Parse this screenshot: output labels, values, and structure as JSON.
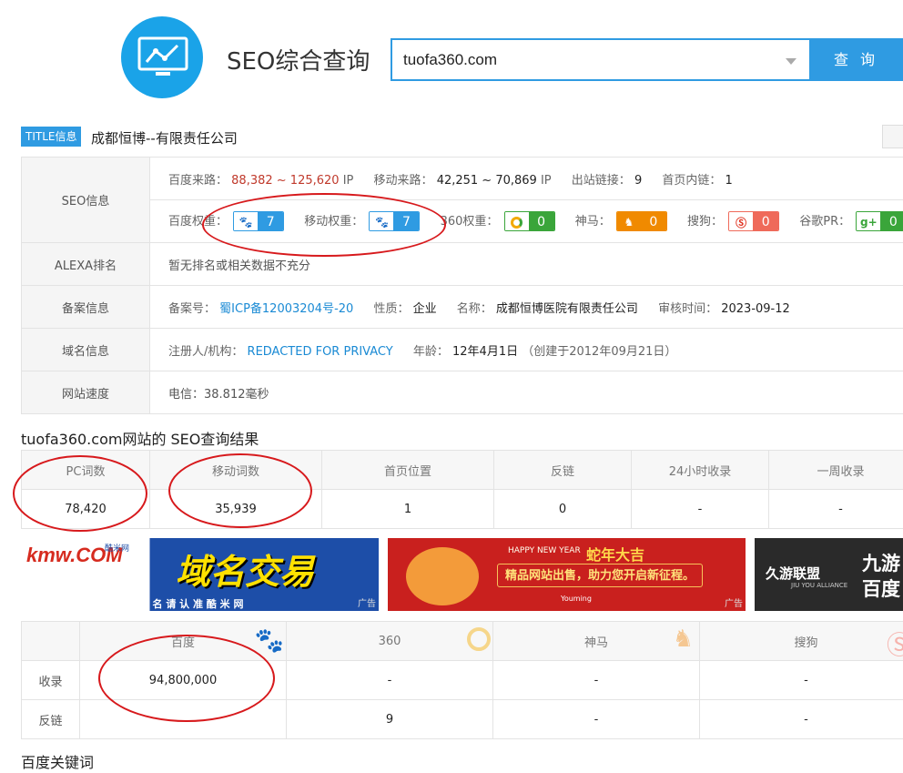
{
  "header": {
    "brand": "SEO综合查询",
    "search_value": "tuofa360.com",
    "search_button": "查 询"
  },
  "title_row": {
    "tag": "TITLE信息",
    "text": "成都恒博--有限责任公司"
  },
  "info": {
    "seo_label": "SEO信息",
    "baidu_traffic_label": "百度来路：",
    "baidu_traffic_value": "88,382 ~ 125,620",
    "ip_unit": "IP",
    "mobile_traffic_label": "移动来路：",
    "mobile_traffic_value": "42,251 ~ 70,869",
    "outbound_label": "出站链接：",
    "outbound_value": "9",
    "home_links_label": "首页内链：",
    "home_links_value": "1",
    "baidu_weight_label": "百度权重：",
    "baidu_weight_value": "7",
    "mobile_weight_label": "移动权重：",
    "mobile_weight_value": "7",
    "weight360_label": "360权重：",
    "weight360_value": "0",
    "shenma_label": "神马：",
    "shenma_value": "0",
    "sogou_label": "搜狗：",
    "sogou_value": "0",
    "google_label": "谷歌PR：",
    "google_value": "0",
    "alexa_label": "ALEXA排名",
    "alexa_value": "暂无排名或相关数据不充分",
    "beian_label": "备案信息",
    "icp_label": "备案号：",
    "icp_value": "蜀ICP备12003204号-20",
    "nature_label": "性质：",
    "nature_value": "企业",
    "name_label": "名称：",
    "name_value": "成都恒博医院有限责任公司",
    "audit_label": "审核时间：",
    "audit_value": "2023-09-12",
    "domain_label": "域名信息",
    "registrant_label": "注册人/机构：",
    "registrant_value": "REDACTED FOR PRIVACY",
    "age_label": "年龄：",
    "age_value": "12年4月1日",
    "created_value": "（创建于2012年09月21日）",
    "speed_label": "网站速度",
    "speed_value": "电信：38.812毫秒"
  },
  "seo_results": {
    "title": "tuofa360.com网站的 SEO查询结果",
    "headers": [
      "PC词数",
      "移动词数",
      "首页位置",
      "反链",
      "24小时收录",
      "一周收录"
    ],
    "values": [
      "78,420",
      "35,939",
      "1",
      "0",
      "-",
      "-"
    ]
  },
  "ads": {
    "ad1_logo": "kmw.COM",
    "ad1_logo_small": "酷米网",
    "ad1_main": "域名交易",
    "ad1_sub": "买 卖 域 名 请 认 准 酷 米 网",
    "ad2_top": "HAPPY NEW YEAR",
    "ad2_title": "蛇年大吉",
    "ad2_main": "精品网站出售，助力您开启新征程。",
    "ad2_brand": "Youming",
    "ad3_brand": "久游联盟",
    "ad3_sub": "JIU YOU ALLIANCE",
    "ad3_side": "九游",
    "ad3_side2": "百度",
    "ad_tag": "广告"
  },
  "engines": {
    "headers": [
      "百度",
      "360",
      "神马",
      "搜狗"
    ],
    "rows": [
      {
        "label": "收录",
        "values": [
          "94,800,000",
          "-",
          "-",
          "-"
        ]
      },
      {
        "label": "反链",
        "values": [
          "",
          "9",
          "-",
          "-"
        ]
      }
    ]
  },
  "bottom_title": "百度关键词",
  "colors": {
    "accent": "#2f9be2",
    "annotation": "#d7191c",
    "value_red": "#c0392b"
  }
}
